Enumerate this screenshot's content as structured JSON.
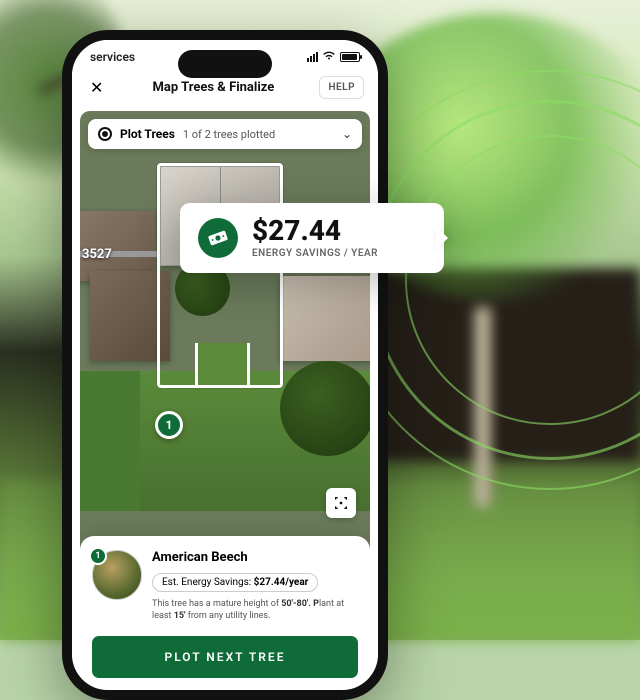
{
  "status": {
    "carrier": "services"
  },
  "nav": {
    "title": "Map Trees & Finalize",
    "help_label": "HELP"
  },
  "plot_bar": {
    "label": "Plot Trees",
    "count_text": "1 of 2 trees plotted"
  },
  "map": {
    "house_number": "3527",
    "pin_number": "1"
  },
  "callout": {
    "amount": "$27.44",
    "subtitle": "ENERGY SAVINGS / YEAR"
  },
  "tree_card": {
    "badge": "1",
    "name": "American Beech",
    "savings_label": "Est. Energy Savings: ",
    "savings_value": "$27.44/year",
    "desc_pre": "This tree has a mature height of ",
    "desc_height": "50'-80'. P",
    "desc_mid": "lant at least ",
    "desc_dist": "15'",
    "desc_post": " from any utility lines."
  },
  "cta": {
    "label": "PLOT NEXT TREE"
  },
  "colors": {
    "brand_green": "#0f6b38"
  }
}
